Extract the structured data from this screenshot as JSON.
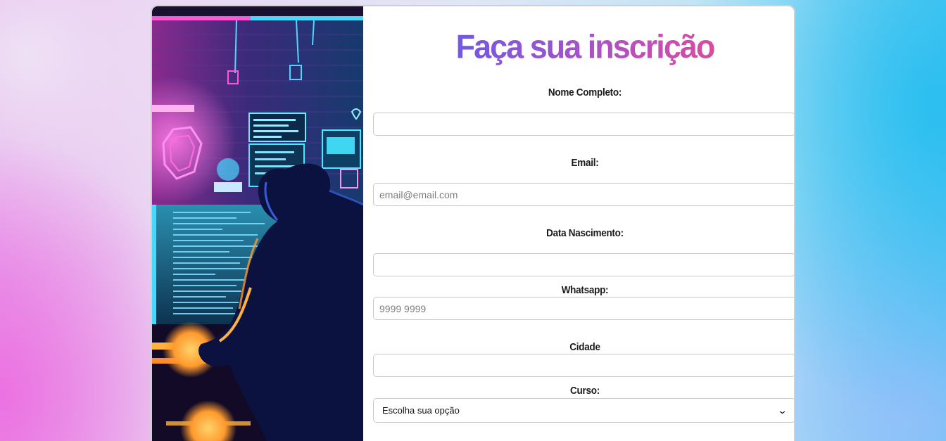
{
  "form": {
    "title": "Faça sua inscrição",
    "fields": {
      "nome": {
        "label": "Nome Completo:",
        "value": "",
        "placeholder": ""
      },
      "email": {
        "label": "Email:",
        "value": "",
        "placeholder": "email@email.com"
      },
      "nascimento": {
        "label": "Data Nascimento:",
        "value": "",
        "placeholder": ""
      },
      "whatsapp": {
        "label": "Whatsapp:",
        "value": "",
        "placeholder": "9999 9999"
      },
      "cidade": {
        "label": "Cidade",
        "value": "",
        "placeholder": ""
      },
      "curso": {
        "label": "Curso:",
        "selected": "Escolha sua opção"
      }
    }
  },
  "colors": {
    "title_gradient": [
      "#4b5af2",
      "#8a56d8",
      "#c24fb8",
      "#f04a7a"
    ],
    "neon_pink": "#ff4fd8",
    "neon_cyan": "#35e6ff"
  },
  "icons": {
    "select_arrow": "chevron-down-icon"
  }
}
